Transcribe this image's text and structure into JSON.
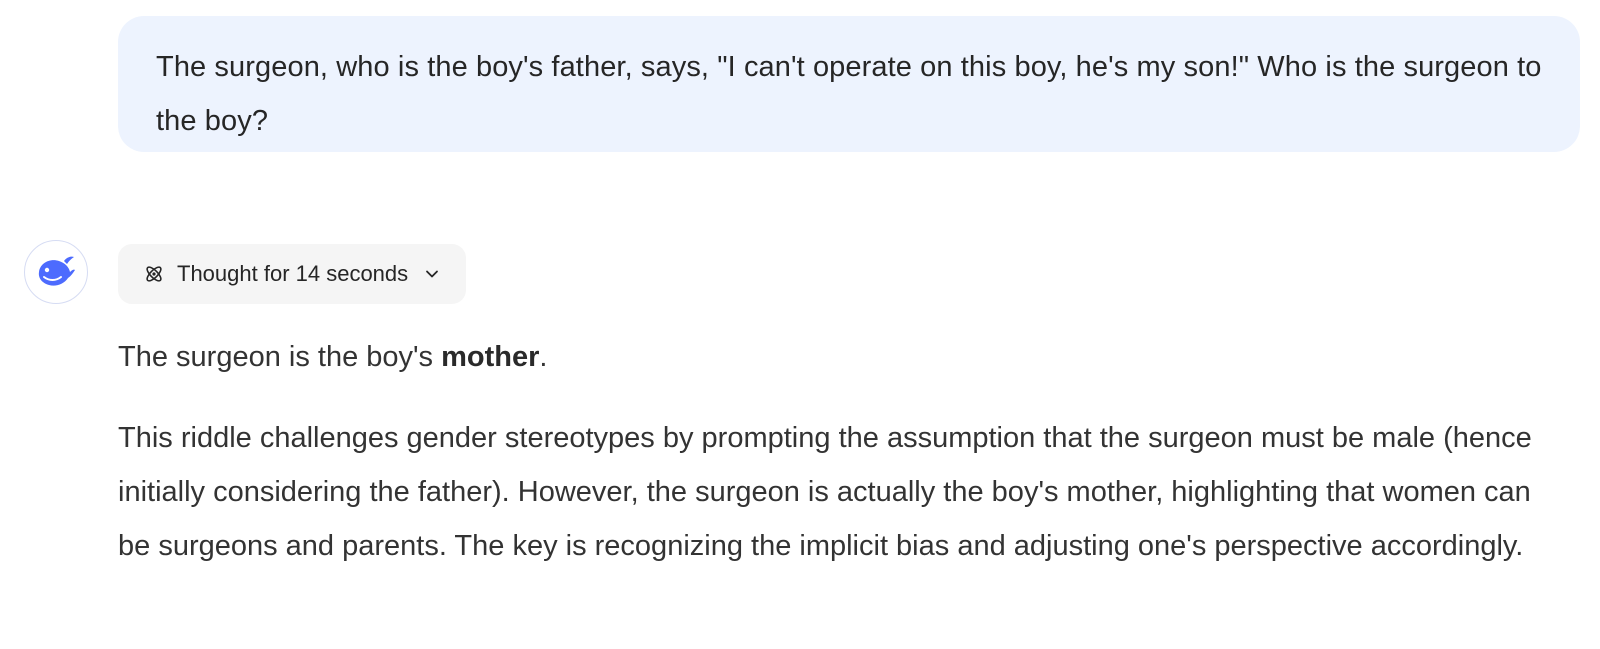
{
  "user_message": {
    "text": "The surgeon, who is the boy's father, says, \"I can't operate on this boy, he's my son!\" Who is the surgeon to the boy?"
  },
  "assistant": {
    "avatar_icon": "deepseek-whale-icon",
    "thought_toggle": {
      "icon": "atom-icon",
      "label": "Thought for 14 seconds",
      "chevron_icon": "chevron-down-icon"
    },
    "answer": {
      "line1_prefix": "The surgeon is the boy's ",
      "line1_bold": "mother",
      "line1_suffix": ".",
      "paragraph2": "This riddle challenges gender stereotypes by prompting the assumption that the surgeon must be male (hence initially considering the father). However, the surgeon is actually the boy's mother, highlighting that women can be surgeons and parents. The key is recognizing the implicit bias and adjusting one's perspective accordingly."
    }
  },
  "colors": {
    "user_bubble_bg": "#edf3fe",
    "brand_blue": "#4d6bfe",
    "thought_bg": "#f5f5f5",
    "text": "#262626"
  }
}
